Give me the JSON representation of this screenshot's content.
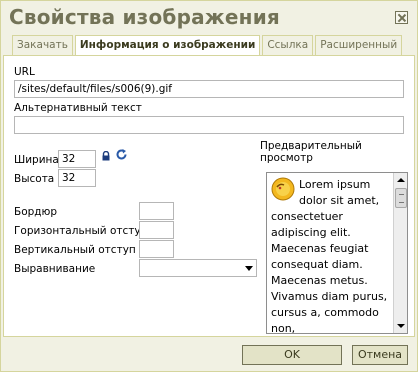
{
  "dialog": {
    "title": "Свойства изображения"
  },
  "tabs": [
    {
      "label": "Закачать"
    },
    {
      "label": "Информация о изображении"
    },
    {
      "label": "Ссылка"
    },
    {
      "label": "Расширенный"
    }
  ],
  "fields": {
    "url_label": "URL",
    "url_value": "/sites/default/files/s006(9).gif",
    "alt_label": "Альтернативный текст",
    "alt_value": "",
    "width_label": "Ширина",
    "width_value": "32",
    "height_label": "Высота",
    "height_value": "32",
    "border_label": "Бордюр",
    "border_value": "",
    "hspace_label": "Горизонтальный отступ",
    "hspace_value": "",
    "vspace_label": "Вертикальный отступ",
    "vspace_value": "",
    "align_label": "Выравнивание",
    "align_value": ""
  },
  "preview": {
    "label": "Предварительный просмотр",
    "text": "Lorem ipsum dolor sit amet, consectetuer adipiscing elit. Maecenas feugiat consequat diam. Maecenas metus. Vivamus diam purus, cursus a, commodo non,"
  },
  "footer": {
    "ok_label": "OK",
    "cancel_label": "Отмена"
  }
}
